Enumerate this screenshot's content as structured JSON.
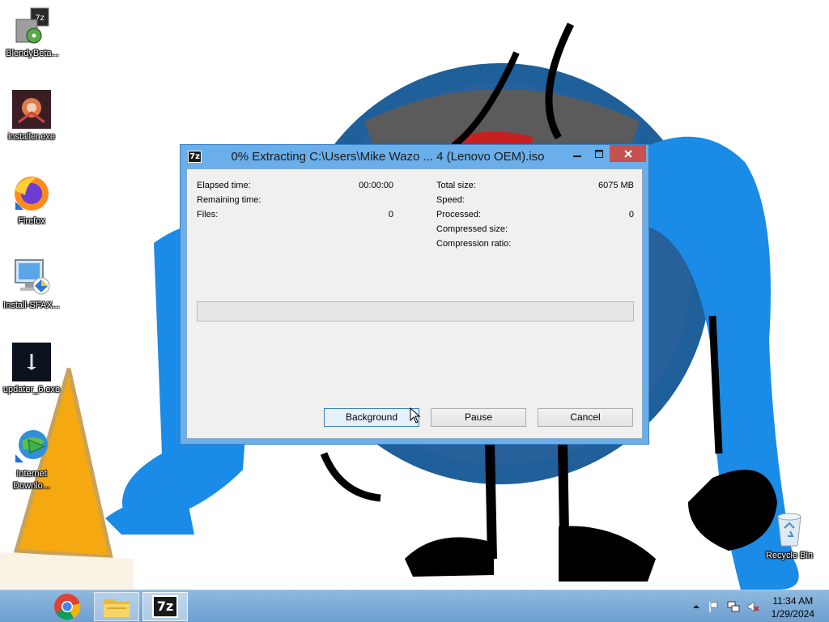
{
  "desktop": {
    "icons": [
      {
        "label": "BlendyBeta...",
        "icon": "installer-disc-icon"
      },
      {
        "label": "installer.exe",
        "icon": "installer-art-icon"
      },
      {
        "label": "Firefox",
        "icon": "firefox-icon"
      },
      {
        "label": "Install-SFAX...",
        "icon": "computer-shield-icon"
      },
      {
        "label": "updater_6.exe",
        "icon": "updater-icon"
      },
      {
        "label": "Internet Downlo...",
        "icon": "internet-download-manager-icon"
      }
    ],
    "recycle_bin": {
      "label": "Recycle Bin",
      "icon": "recycle-bin-icon"
    }
  },
  "dialog": {
    "title": "0% Extracting C:\\Users\\Mike Wazo ... 4 (Lenovo OEM).iso",
    "app_icon_text": "7z",
    "controls": {
      "minimize": "minimize-icon",
      "maximize": "maximize-icon",
      "close": "close-icon"
    },
    "stats_left": [
      {
        "key": "Elapsed time:",
        "value": "00:00:00"
      },
      {
        "key": "Remaining time:",
        "value": ""
      },
      {
        "key": "Files:",
        "value": "0"
      }
    ],
    "stats_right": [
      {
        "key": "Total size:",
        "value": "6075 MB"
      },
      {
        "key": "Speed:",
        "value": ""
      },
      {
        "key": "Processed:",
        "value": "0"
      },
      {
        "key": "Compressed size:",
        "value": ""
      },
      {
        "key": "Compression ratio:",
        "value": ""
      }
    ],
    "progress_percent": 0,
    "buttons": {
      "background": "Background",
      "pause": "Pause",
      "cancel": "Cancel"
    }
  },
  "taskbar": {
    "apps": [
      {
        "icon": "chrome-icon"
      },
      {
        "icon": "file-explorer-icon"
      },
      {
        "icon": "7zip-icon",
        "text": "7z"
      }
    ],
    "tray": [
      "show-hidden-icons-icon",
      "action-center-flag-icon",
      "network-icon",
      "volume-muted-icon"
    ],
    "time": "11:34 AM",
    "date": "1/29/2024"
  },
  "colors": {
    "window_frame": "#6aaeea",
    "close_button": "#c75050",
    "taskbar": "#7fb0de"
  }
}
